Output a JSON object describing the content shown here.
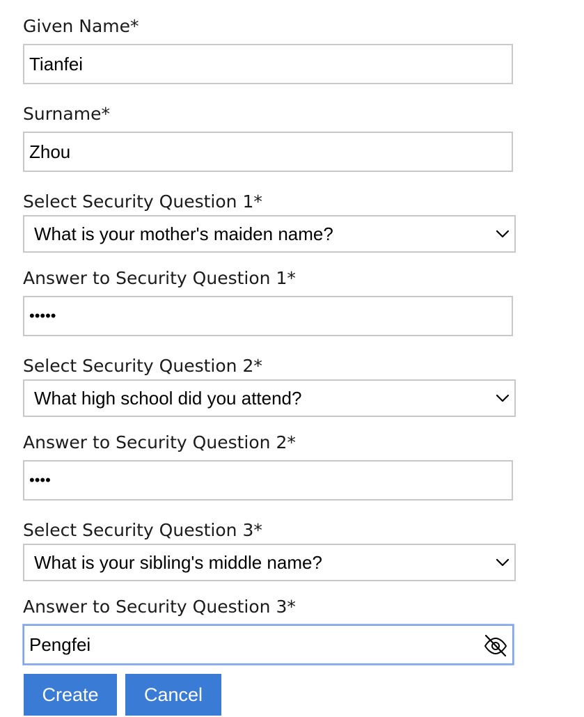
{
  "form": {
    "given_name": {
      "label": "Given Name*",
      "value": "Tianfei"
    },
    "surname": {
      "label": "Surname*",
      "value": "Zhou"
    },
    "question1": {
      "label": "Select Security Question 1*",
      "selected": "What is your mother's maiden name?"
    },
    "answer1": {
      "label": "Answer to Security Question 1*",
      "masked_value": "•••••"
    },
    "question2": {
      "label": "Select Security Question 2*",
      "selected": "What high school did you attend?"
    },
    "answer2": {
      "label": "Answer to Security Question 2*",
      "masked_value": "••••"
    },
    "question3": {
      "label": "Select Security Question 3*",
      "selected": "What is your sibling's middle name?"
    },
    "answer3": {
      "label": "Answer to Security Question 3*",
      "value": "Pengfei",
      "visibility_icon": "eye-slash-icon"
    }
  },
  "buttons": {
    "create": "Create",
    "cancel": "Cancel"
  },
  "colors": {
    "primary_button": "#3a7bd5",
    "focus_border": "#7fa6e8",
    "input_border": "#c8c8c8"
  }
}
